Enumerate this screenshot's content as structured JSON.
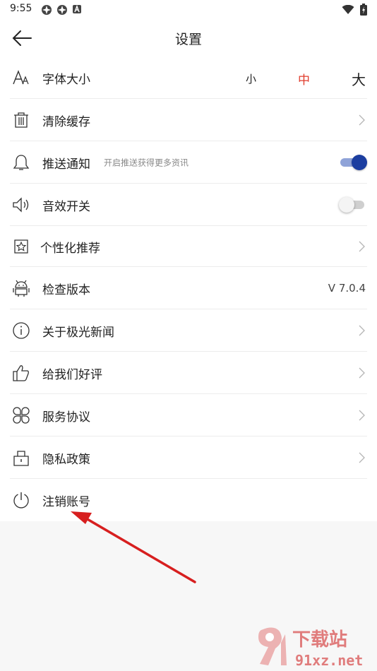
{
  "status": {
    "time": "9:55"
  },
  "header": {
    "title": "设置"
  },
  "colors": {
    "accent": "#e03c2c",
    "toggle_on": "#1c3ea0",
    "arrow": "#d71f1f"
  },
  "font_size": {
    "label": "字体大小",
    "small": "小",
    "medium": "中",
    "large": "大",
    "selected": "中"
  },
  "rows": {
    "clear_cache": {
      "label": "清除缓存",
      "icon": "trash-icon"
    },
    "push": {
      "label": "推送通知",
      "hint": "开启推送获得更多资讯",
      "toggle": true,
      "icon": "bell-icon"
    },
    "sound": {
      "label": "音效开关",
      "toggle": false,
      "icon": "speaker-icon"
    },
    "personal": {
      "label": "个性化推荐",
      "icon": "star-frame-icon"
    },
    "version": {
      "label": "检查版本",
      "value": "V 7.0.4",
      "icon": "android-icon"
    },
    "about": {
      "label": "关于极光新闻",
      "icon": "info-icon"
    },
    "rate": {
      "label": "给我们好评",
      "icon": "thumbs-up-icon"
    },
    "service": {
      "label": "服务协议",
      "icon": "clover-icon"
    },
    "privacy": {
      "label": "隐私政策",
      "icon": "lock-icon"
    },
    "logout": {
      "label": "注销账号",
      "icon": "power-icon"
    }
  },
  "watermark": {
    "brand": "下载站",
    "domain": "91xz.net"
  }
}
